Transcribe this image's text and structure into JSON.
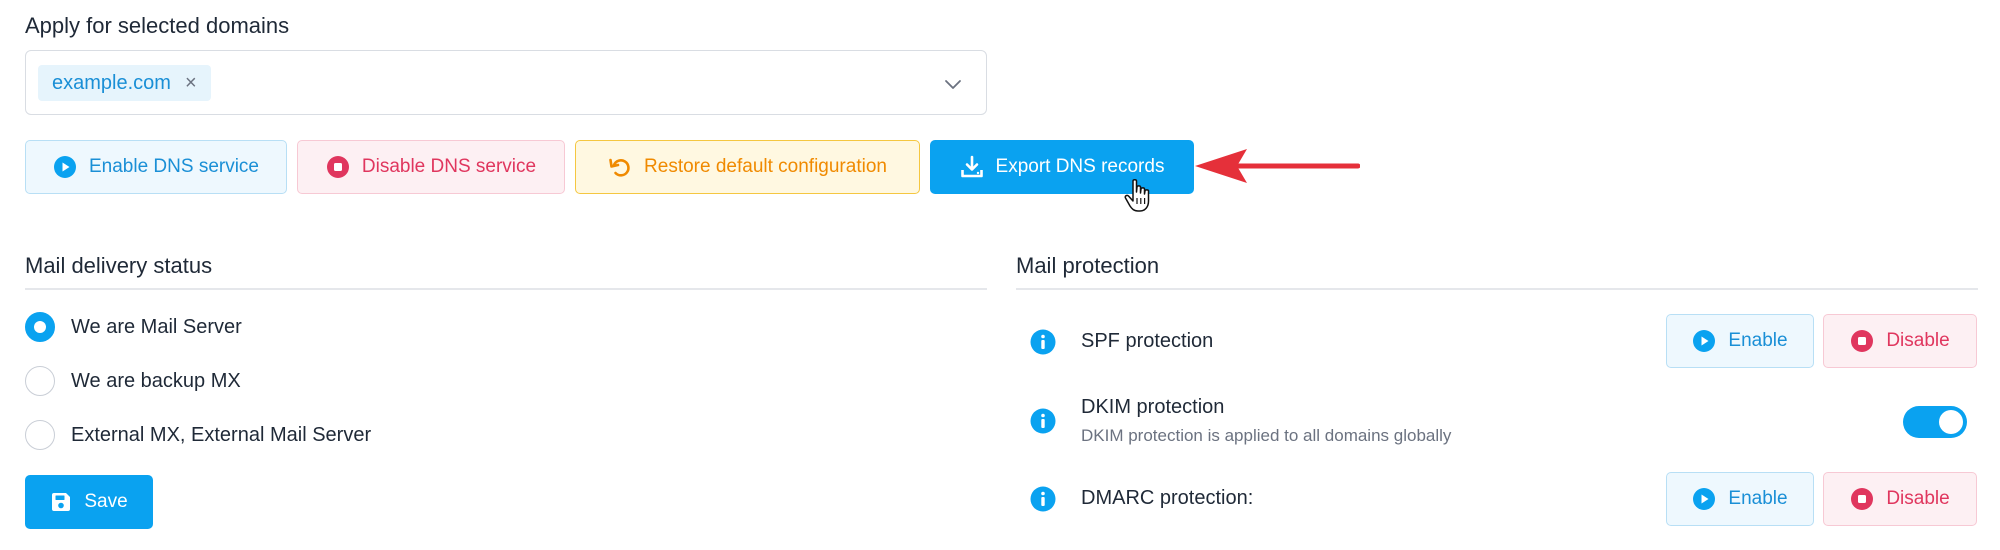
{
  "domains": {
    "title": "Apply for selected domains",
    "selected": [
      {
        "label": "example.com",
        "remove": "×"
      }
    ]
  },
  "actions": {
    "enable_dns": "Enable DNS service",
    "disable_dns": "Disable DNS service",
    "restore": "Restore default configuration",
    "export": "Export DNS records"
  },
  "mail_delivery": {
    "title": "Mail delivery status",
    "options": [
      {
        "label": "We are Mail Server",
        "checked": true
      },
      {
        "label": "We are backup MX",
        "checked": false
      },
      {
        "label": "External MX, External Mail Server",
        "checked": false
      }
    ],
    "save_label": "Save"
  },
  "mail_protection": {
    "title": "Mail protection",
    "spf": {
      "label": "SPF protection",
      "enable": "Enable",
      "disable": "Disable"
    },
    "dkim": {
      "label": "DKIM protection",
      "sub": "DKIM protection is applied to all domains globally",
      "enabled": true
    },
    "dmarc": {
      "label": "DMARC protection:",
      "enable": "Enable",
      "disable": "Disable"
    }
  },
  "colors": {
    "primary": "#0aa2f0",
    "danger": "#e0365e",
    "warning": "#f08a00",
    "arrow": "#e5303a"
  },
  "icons": {
    "enable": "play-circle-icon",
    "disable": "stop-circle-icon",
    "restore": "undo-icon",
    "export": "download-icon",
    "save": "floppy-disk-icon",
    "info": "info-icon",
    "chevron": "chevron-down-icon"
  }
}
